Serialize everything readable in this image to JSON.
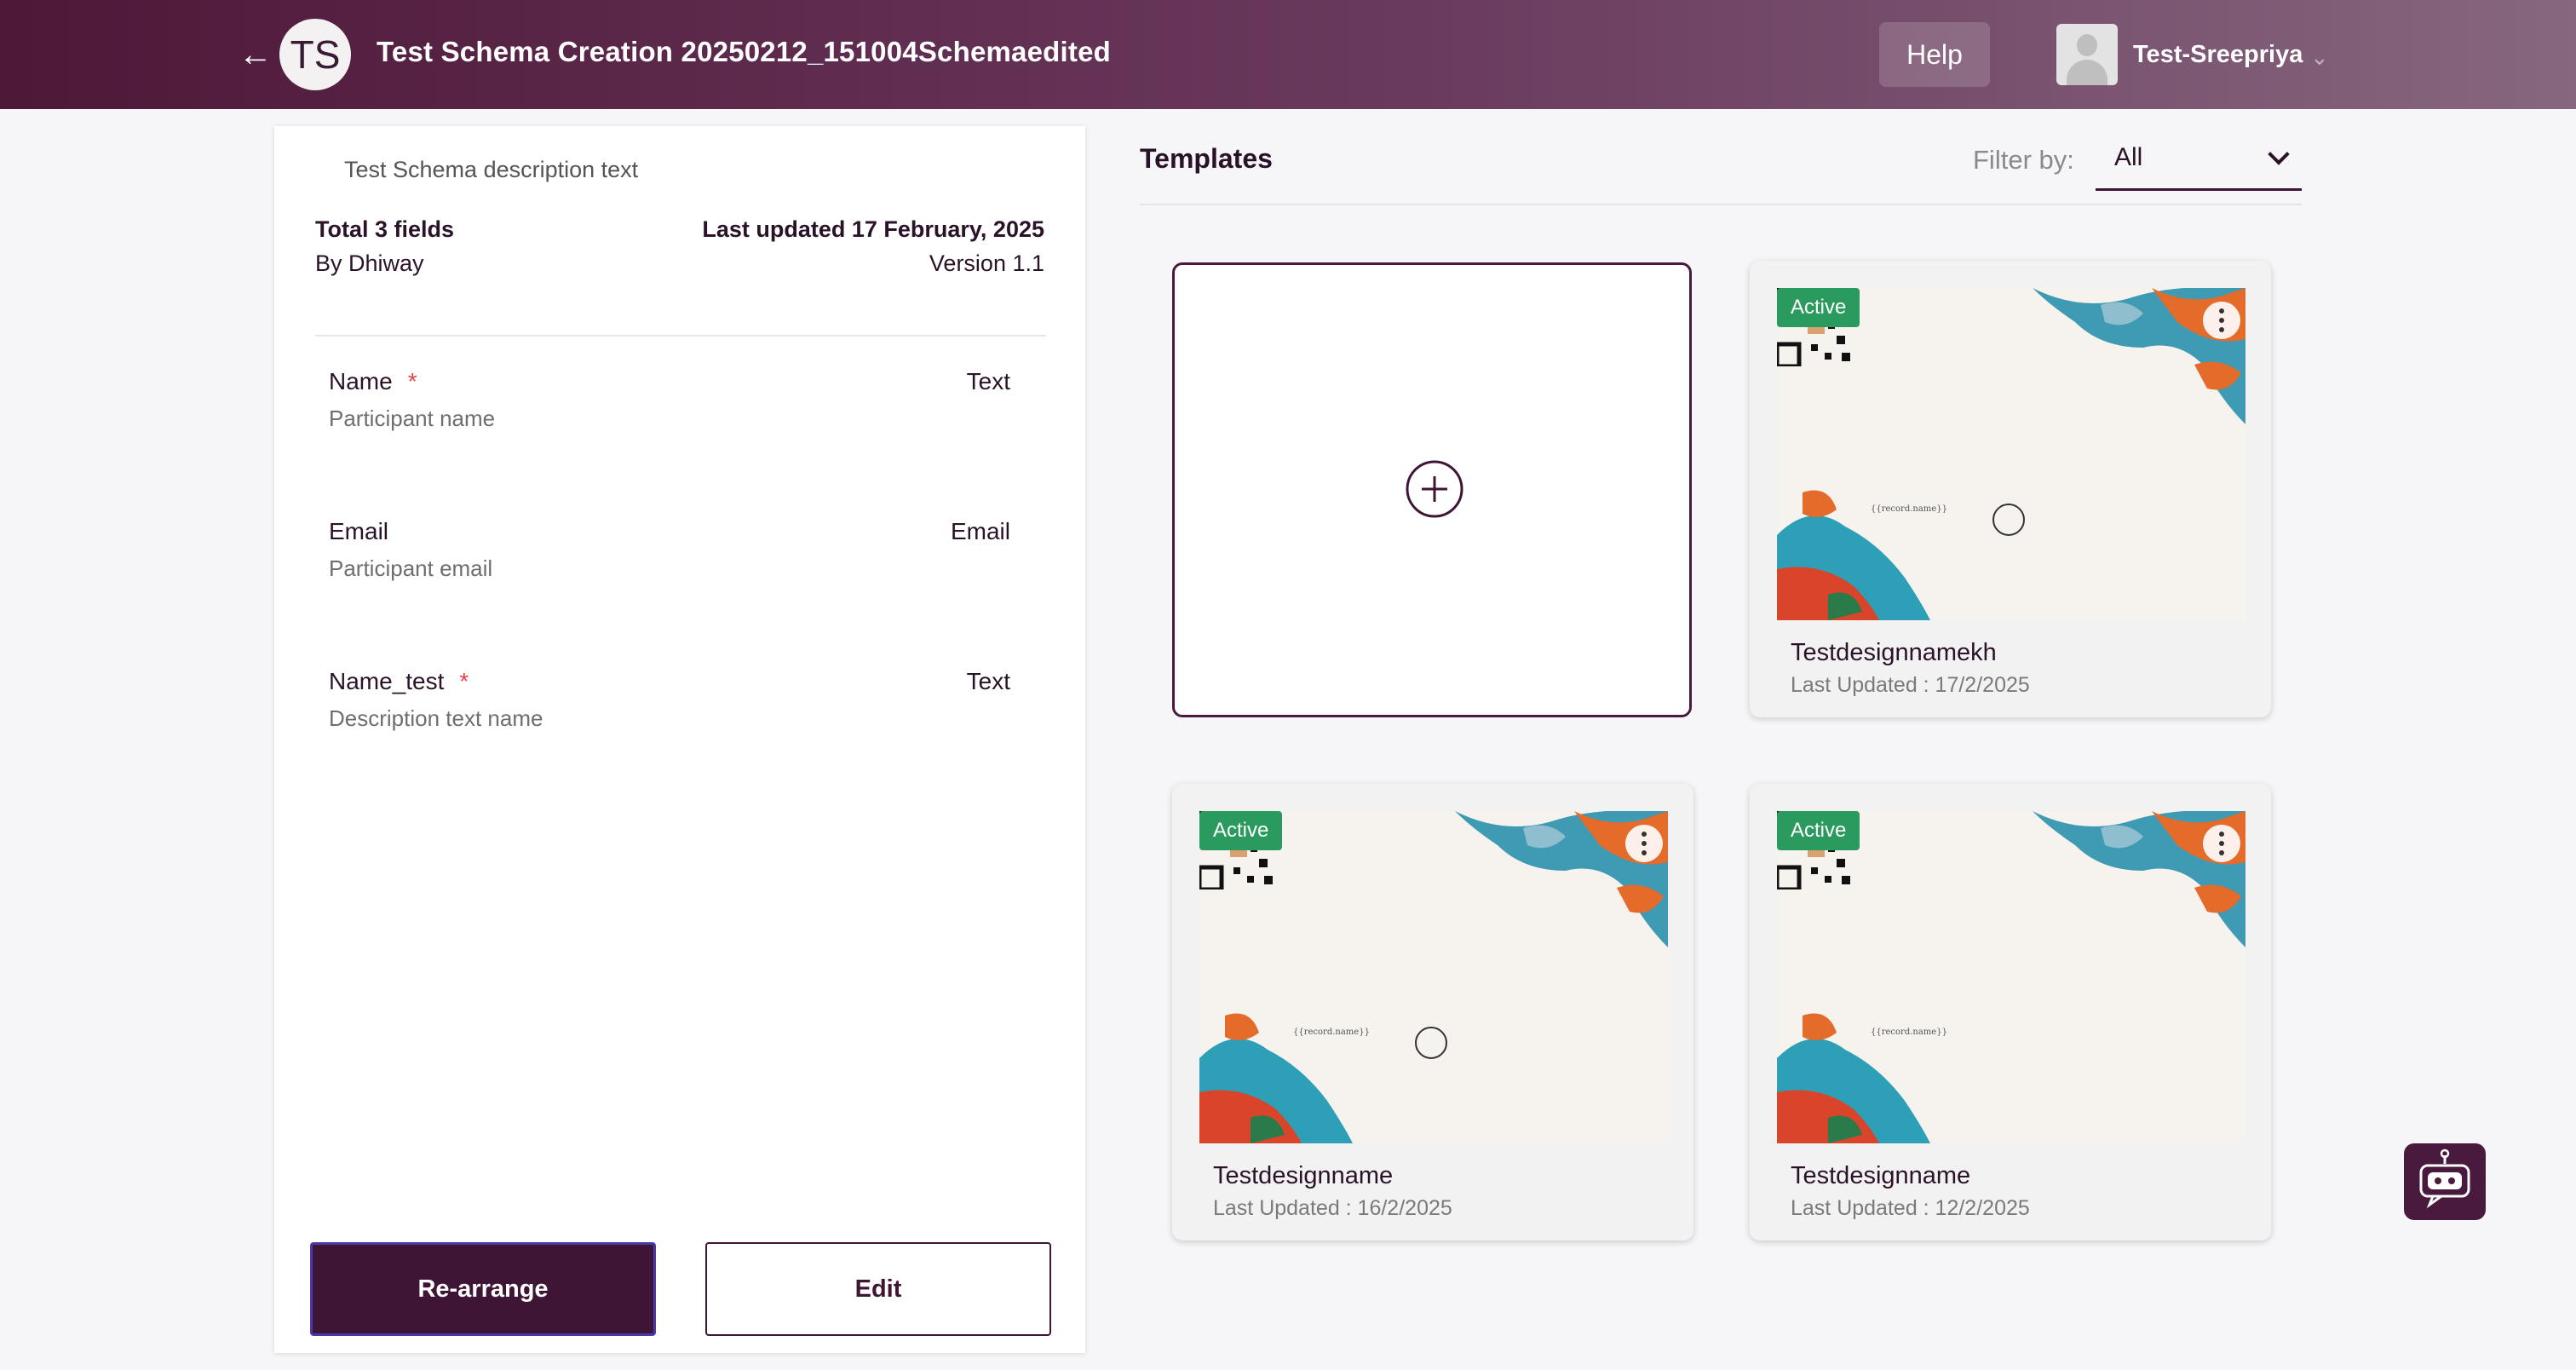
{
  "header": {
    "back_icon": "arrow-left-icon",
    "initials": "TS",
    "title": "Test Schema Creation 20250212_151004Schemaedited",
    "help_label": "Help",
    "user_name": "Test-Sreepriya"
  },
  "schema": {
    "description": "Test Schema description text",
    "total_fields": "Total 3 fields",
    "by": "By Dhiway",
    "last_updated": "Last updated 17 February, 2025",
    "version": "Version  1.1",
    "fields": [
      {
        "name": "Name",
        "required": "*",
        "type": "Text",
        "description": "Participant name"
      },
      {
        "name": "Email",
        "required": "",
        "type": "Email",
        "description": "Participant email"
      },
      {
        "name": "Name_test",
        "required": "*",
        "type": "Text",
        "description": "Description text name"
      }
    ],
    "rearrange_label": "Re-arrange",
    "edit_label": "Edit"
  },
  "templates": {
    "heading": "Templates",
    "filter_label": "Filter by:",
    "filter_value": "All",
    "placeholder_text": "{{record.name}}",
    "cards": [
      {
        "status": "Active",
        "name": "Testdesignnamekh",
        "updated": "Last Updated : 17/2/2025"
      },
      {
        "status": "Active",
        "name": "Testdesignname",
        "updated": "Last Updated : 16/2/2025"
      },
      {
        "status": "Active",
        "name": "Testdesignname",
        "updated": "Last Updated : 12/2/2025"
      }
    ]
  },
  "colors": {
    "brand": "#4e1838",
    "active_badge": "#2b9a5e",
    "required": "#e0434e"
  }
}
